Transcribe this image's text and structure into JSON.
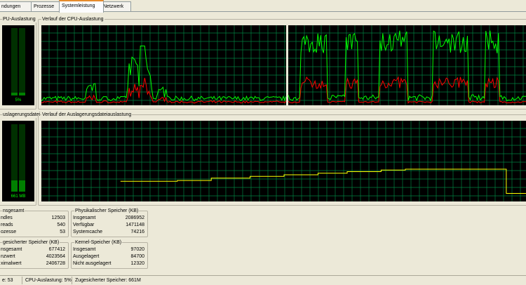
{
  "tabs": [
    {
      "label": "ndungen"
    },
    {
      "label": "Prozesse"
    },
    {
      "label": "Systemleistung"
    },
    {
      "label": "Netzwerk"
    }
  ],
  "cpu_meter": {
    "title": "PU-Auslastung",
    "value_text": "5%",
    "percent": 5
  },
  "cpu_history": {
    "title": "Verlauf der CPU-Auslastung"
  },
  "page_meter": {
    "title": "uslagerungsdatei",
    "value_text": "661 MB",
    "percent": 16
  },
  "page_history": {
    "title": "Verlauf der Auslagerungsdateiauslastung"
  },
  "totals": {
    "title": "nsgesamt",
    "rows": [
      {
        "label": "ndles",
        "value": "12503"
      },
      {
        "label": "reads",
        "value": "540"
      },
      {
        "label": "ozesse",
        "value": "53"
      }
    ]
  },
  "physical": {
    "title": "Physikalischer Speicher (KB)",
    "rows": [
      {
        "label": "Insgesamt",
        "value": "2086952"
      },
      {
        "label": "Verfügbar",
        "value": "1471148"
      },
      {
        "label": "Systemcache",
        "value": "74216"
      }
    ]
  },
  "commit": {
    "title": "gesicherter Speicher (KB)",
    "rows": [
      {
        "label": "nsgesamt",
        "value": "677412"
      },
      {
        "label": "nzwert",
        "value": "4023564"
      },
      {
        "label": "ximalwert",
        "value": "2406728"
      }
    ]
  },
  "kernel": {
    "title": "Kernel-Speicher (KB)",
    "rows": [
      {
        "label": "Insgesamt",
        "value": "97020"
      },
      {
        "label": "Ausgelagert",
        "value": "84700"
      },
      {
        "label": "Nicht ausgelagert",
        "value": "12320"
      }
    ]
  },
  "status": {
    "processes": "e: 53",
    "cpu": "CPU-Auslastung: 5%",
    "commit": "Zugesicherter Speicher: 661M"
  },
  "colors": {
    "grid": "#008040",
    "cpu_total": "#00ff00",
    "cpu_kernel": "#ff0000",
    "pagefile": "#ffff00",
    "meter_off": "#006000",
    "meter_on": "#00ff00"
  }
}
